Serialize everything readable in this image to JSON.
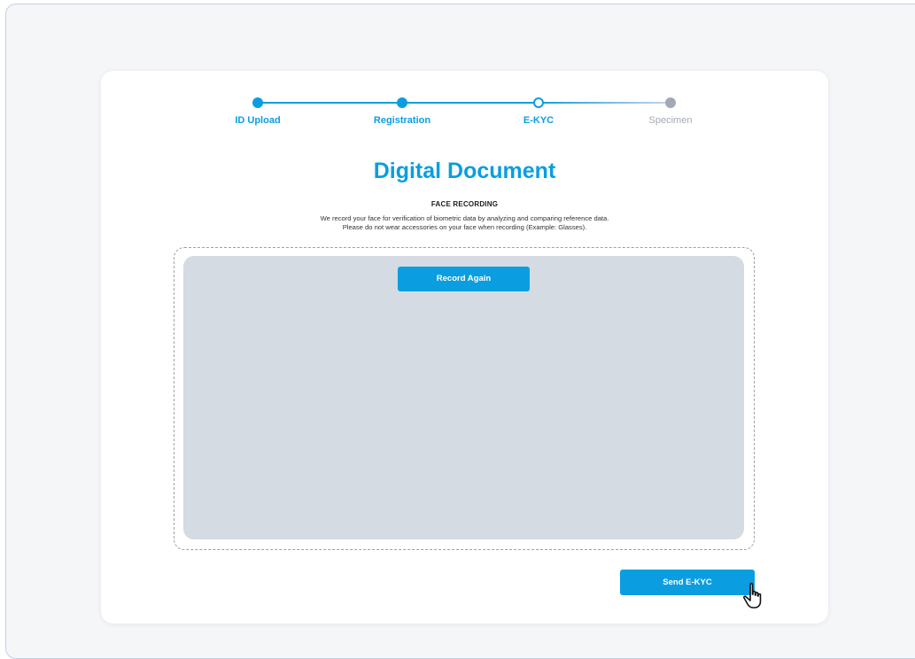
{
  "stepper": {
    "steps": [
      {
        "label": "ID Upload",
        "state": "completed"
      },
      {
        "label": "Registration",
        "state": "completed"
      },
      {
        "label": "E-KYC",
        "state": "current"
      },
      {
        "label": "Specimen",
        "state": "pending"
      }
    ]
  },
  "page": {
    "title": "Digital Document",
    "section_title": "FACE RECORDING",
    "description_line1": "We record your face for verification of biometric data by analyzing and comparing reference data.",
    "description_line2": "Please do not wear accessories on your face when recording (Example: Glasses)."
  },
  "recorder": {
    "record_again_label": "Record Again"
  },
  "actions": {
    "send_label": "Send E-KYC"
  },
  "colors": {
    "accent": "#0a9ee0",
    "pending": "#a3a9b4",
    "video_bg": "#d5dbe3"
  },
  "icons": {
    "cursor": "hand-pointer-icon"
  }
}
